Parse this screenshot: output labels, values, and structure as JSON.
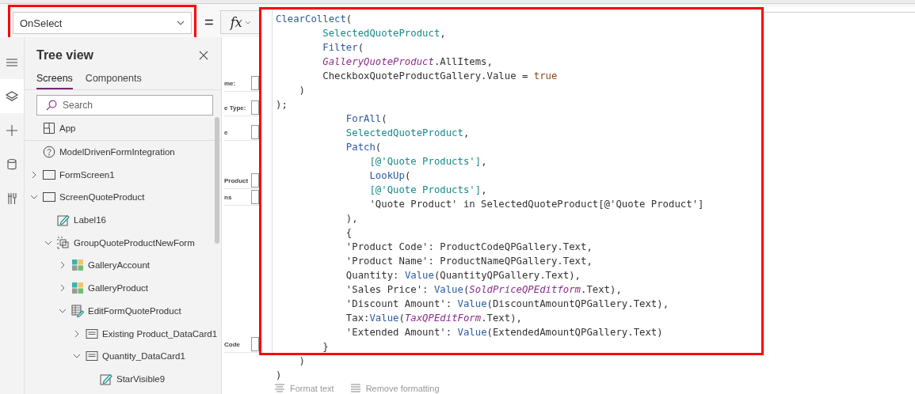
{
  "property_selector": {
    "value": "OnSelect",
    "highlighted": true
  },
  "equals_sign": "=",
  "fx_button": {
    "label": "fx"
  },
  "left_rail": [
    {
      "selected": false
    },
    {
      "selected": true
    },
    {
      "selected": false
    },
    {
      "selected": false
    },
    {
      "selected": false
    }
  ],
  "tree_view": {
    "title": "Tree view",
    "tabs": [
      {
        "label": "Screens",
        "selected": true
      },
      {
        "label": "Components",
        "selected": false
      }
    ],
    "search": {
      "placeholder": "Search"
    },
    "items": [
      {
        "label": "App",
        "kind": "app"
      },
      {
        "label": "ModelDrivenFormIntegration",
        "kind": "help"
      },
      {
        "label": "FormScreen1",
        "kind": "screen",
        "expanded": false
      },
      {
        "label": "ScreenQuoteProduct",
        "kind": "screen",
        "expanded": true,
        "children": [
          {
            "label": "Label16",
            "kind": "label"
          },
          {
            "label": "GroupQuoteProductNewForm",
            "kind": "group",
            "expanded": true,
            "children": [
              {
                "label": "GalleryAccount",
                "kind": "gallery",
                "expanded": false
              },
              {
                "label": "GalleryProduct",
                "kind": "gallery",
                "expanded": false
              },
              {
                "label": "EditFormQuoteProduct",
                "kind": "form",
                "expanded": true,
                "children": [
                  {
                    "label": "Existing Product_DataCard1",
                    "kind": "card",
                    "expanded": false
                  },
                  {
                    "label": "Quantity_DataCard1",
                    "kind": "card",
                    "expanded": true,
                    "children": [
                      {
                        "label": "StarVisible9",
                        "kind": "label"
                      }
                    ]
                  }
                ]
              }
            ]
          }
        ]
      }
    ]
  },
  "canvas_fragments": [
    "me:",
    "e Type:",
    "e",
    "Product",
    "ns",
    "Code"
  ],
  "formula": {
    "highlighted": true,
    "lines": [
      [
        {
          "kind": "fn",
          "t": "ClearCollect"
        },
        {
          "kind": "plain",
          "t": "("
        }
      ],
      [
        {
          "kind": "id",
          "t": "        SelectedQuoteProduct"
        },
        {
          "kind": "plain",
          "t": ","
        }
      ],
      [
        {
          "kind": "fn",
          "t": "        Filter"
        },
        {
          "kind": "plain",
          "t": "("
        }
      ],
      [
        {
          "kind": "ctl",
          "t": "        GalleryQuoteProduct"
        },
        {
          "kind": "plain",
          "t": ".AllItems,"
        }
      ],
      [
        {
          "kind": "plain",
          "t": "        CheckboxQuoteProductGallery.Value = "
        },
        {
          "kind": "lit",
          "t": "true"
        }
      ],
      [
        {
          "kind": "plain",
          "t": "    )"
        }
      ],
      [
        {
          "kind": "plain",
          "t": ");"
        }
      ],
      [
        {
          "kind": "fn",
          "t": "            ForAll"
        },
        {
          "kind": "plain",
          "t": "("
        }
      ],
      [
        {
          "kind": "id",
          "t": "            SelectedQuoteProduct"
        },
        {
          "kind": "plain",
          "t": ","
        }
      ],
      [
        {
          "kind": "fn",
          "t": "            Patch"
        },
        {
          "kind": "plain",
          "t": "("
        }
      ],
      [
        {
          "kind": "id",
          "t": "                [@'Quote Products']"
        },
        {
          "kind": "plain",
          "t": ","
        }
      ],
      [
        {
          "kind": "fn",
          "t": "                LookUp"
        },
        {
          "kind": "plain",
          "t": "("
        }
      ],
      [
        {
          "kind": "id",
          "t": "                [@'Quote Products']"
        },
        {
          "kind": "plain",
          "t": ","
        }
      ],
      [
        {
          "kind": "plain",
          "t": "                'Quote Product' in SelectedQuoteProduct[@'Quote Product']"
        }
      ],
      [
        {
          "kind": "plain",
          "t": "            ),"
        }
      ],
      [
        {
          "kind": "plain",
          "t": "            {"
        }
      ],
      [
        {
          "kind": "plain",
          "t": "            'Product Code': ProductCodeQPGallery.Text,"
        }
      ],
      [
        {
          "kind": "plain",
          "t": "            'Product Name': ProductNameQPGallery.Text,"
        }
      ],
      [
        {
          "kind": "plain",
          "t": "            Quantity: "
        },
        {
          "kind": "fn",
          "t": "Value"
        },
        {
          "kind": "plain",
          "t": "(QuantityQPGallery.Text),"
        }
      ],
      [
        {
          "kind": "plain",
          "t": "            'Sales Price': "
        },
        {
          "kind": "fn",
          "t": "Value"
        },
        {
          "kind": "plain",
          "t": "("
        },
        {
          "kind": "ctl",
          "t": "SoldPriceQPEditform"
        },
        {
          "kind": "plain",
          "t": ".Text),"
        }
      ],
      [
        {
          "kind": "plain",
          "t": "            'Discount Amount': "
        },
        {
          "kind": "fn",
          "t": "Value"
        },
        {
          "kind": "plain",
          "t": "(DiscountAmountQPGallery.Text),"
        }
      ],
      [
        {
          "kind": "plain",
          "t": "            Tax:"
        },
        {
          "kind": "fn",
          "t": "Value"
        },
        {
          "kind": "plain",
          "t": "("
        },
        {
          "kind": "ctl",
          "t": "TaxQPEditForm"
        },
        {
          "kind": "plain",
          "t": ".Text),"
        }
      ],
      [
        {
          "kind": "plain",
          "t": "            'Extended Amount': "
        },
        {
          "kind": "fn",
          "t": "Value"
        },
        {
          "kind": "plain",
          "t": "(ExtendedAmountQPGallery.Text)"
        }
      ],
      [
        {
          "kind": "plain",
          "t": "        }"
        }
      ],
      [
        {
          "kind": "plain",
          "t": "    )"
        }
      ],
      [
        {
          "kind": "plain",
          "t": ")"
        }
      ]
    ]
  },
  "format_toolbar": [
    {
      "label": "Format text",
      "kind": "format"
    },
    {
      "label": "Remove formatting",
      "kind": "remove"
    }
  ]
}
